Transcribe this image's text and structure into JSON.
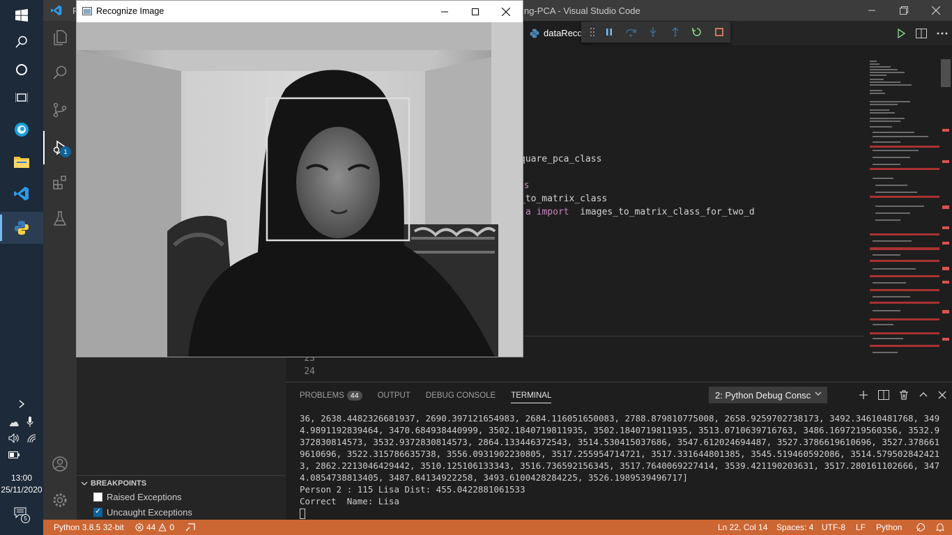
{
  "windows_taskbar": {
    "time": "13:00",
    "date": "25/11/2020",
    "notification_count": "5"
  },
  "vscode": {
    "title": "ng-PCA - Visual Studio Code",
    "title_prefix": "F",
    "debug_badge": "1",
    "tab_label": "dataRecor",
    "code": {
      "line1": "quare_pca_class",
      "line2": "ses",
      "line3": "_to_matrix_class",
      "line4_kw": "a import",
      "line4_rest": "  images_to_matrix_class_for_two_d",
      "ln23": "23",
      "ln24": "24"
    },
    "sidebar": {
      "breakpoints_header": "BREAKPOINTS",
      "items": [
        {
          "label": "Raised Exceptions",
          "checked": false
        },
        {
          "label": "Uncaught Exceptions",
          "checked": true
        }
      ]
    },
    "panel": {
      "tabs": {
        "problems": "PROBLEMS",
        "problems_count": "44",
        "output": "OUTPUT",
        "debug_console": "DEBUG CONSOLE",
        "terminal": "TERMINAL"
      },
      "terminal_select": "2: Python Debug Consc",
      "terminal_output": "36, 2638.4482326681937, 2690.397121654983, 2684.116051650083, 2788.879810775008, 2658.9259702738173, 3492.34610481768, 3494.9891192839464, 3470.684938440999, 3502.1840719811935, 3502.1840719811935, 3513.0710639716763, 3486.1697219560356, 3532.9372830814573, 3532.9372830814573, 2864.133446372543, 3514.530415037686, 3547.612024694487, 3527.3786619610696, 3527.3786619610696, 3522.315786635738, 3556.0931902230805, 3517.255954714721, 3517.331644801385, 3545.519460592086, 3514.5795028424213, 2862.2213046429442, 3510.125106133343, 3516.736592156345, 3517.7640069227414, 3539.421190203631, 3517.280161102666, 3474.0854738813405, 3487.84134922258, 3493.6100428284225, 3526.1989539496717]",
      "result_line": "Person 2 : 115 Lisa Dist: 455.0422881061533",
      "correct_line": "Correct  Name: Lisa"
    },
    "statusbar": {
      "python": "Python 3.8.5 32-bit",
      "errors": "44",
      "warnings": "0",
      "position": "Ln 22, Col 14",
      "spaces": "Spaces: 4",
      "encoding": "UTF-8",
      "eol": "LF",
      "language": "Python"
    }
  },
  "cv_window": {
    "title": "Recognize Image"
  },
  "colors": {
    "statusbar": "#cc6633",
    "accent": "#0e639c"
  }
}
